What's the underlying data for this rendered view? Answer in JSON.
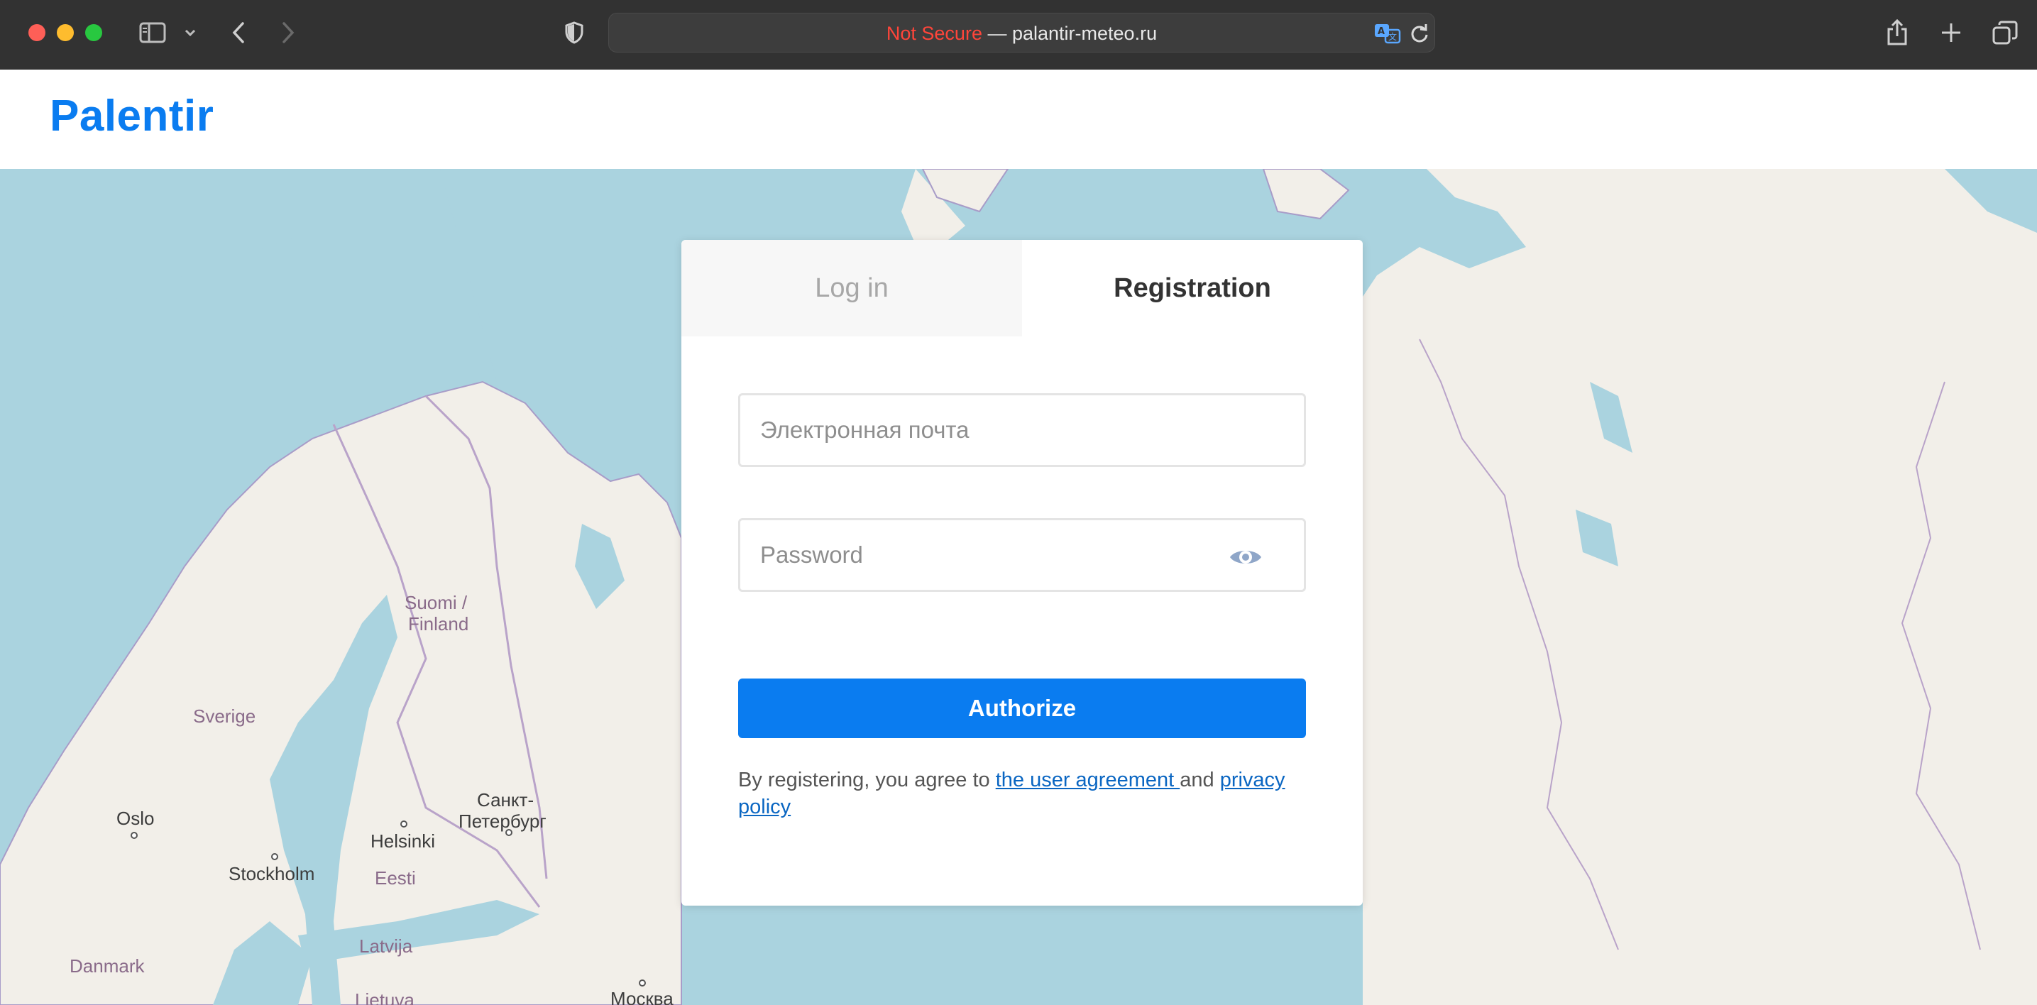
{
  "browser": {
    "address_prefix": "Not Secure",
    "address_separator": " — ",
    "address_host": "palantir-meteo.ru"
  },
  "site": {
    "brand": "Palentir"
  },
  "map_labels": {
    "finland_line1": "Suomi /",
    "finland_line2": "Finland",
    "sweden": "Sverige",
    "oslo": "Oslo",
    "stockholm": "Stockholm",
    "helsinki": "Helsinki",
    "spb_line1": "Санкт-",
    "spb_line2": "Петербург",
    "estonia": "Eesti",
    "latvia": "Latvija",
    "denmark": "Danmark",
    "lithuania": "Lietuva",
    "moscow": "Москва"
  },
  "auth": {
    "tabs": {
      "login": "Log in",
      "register": "Registration"
    },
    "email_placeholder": "Электронная почта",
    "password_placeholder": "Password",
    "submit_label": "Authorize",
    "terms_prefix": "By registering, you agree to ",
    "terms_link_agreement": "the user agreement ",
    "terms_and": "and ",
    "terms_link_privacy": "privacy policy"
  },
  "colors": {
    "brand": "#0a7cf0",
    "sea": "#aad3df",
    "land": "#f2efe9"
  }
}
